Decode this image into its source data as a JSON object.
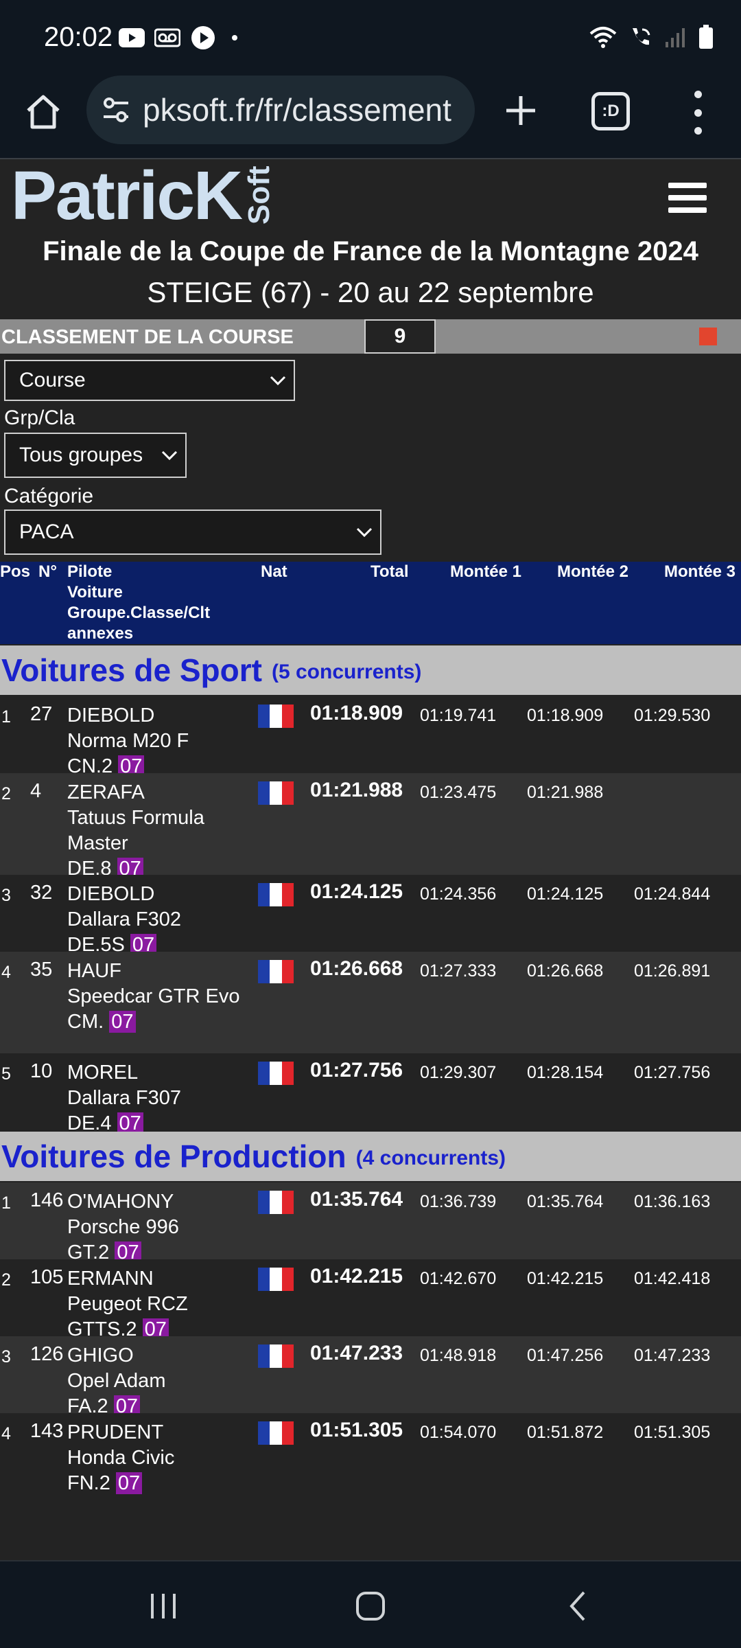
{
  "status_bar": {
    "time": "20:02",
    "left_icons": [
      "youtube-icon",
      "voicemail-icon",
      "play-icon"
    ],
    "right_icons": [
      "wifi-icon",
      "call-icon",
      "signal-icon",
      "battery-icon"
    ]
  },
  "browser": {
    "url": "pksoft.fr/fr/classement",
    "tabs_label": ":D"
  },
  "header": {
    "logo_main": "PatricK",
    "logo_suffix": "Soft",
    "title": "Finale de la Coupe de France de la Montagne 2024",
    "subtitle": "STEIGE (67) - 20 au 22 septembre"
  },
  "classement": {
    "label": "CLASSEMENT DE LA COURSE",
    "number": "9"
  },
  "filters": {
    "course_value": "Course",
    "grp_label": "Grp/Cla",
    "grp_value": "Tous groupes",
    "categorie_label": "Catégorie",
    "categorie_value": "PACA"
  },
  "table_header": {
    "pos": "Pos",
    "num": "N°",
    "pilote": "Pilote",
    "voiture": "Voiture",
    "groupe": "Groupe.Classe/Clt",
    "annexes": "annexes",
    "nat": "Nat",
    "total": "Total",
    "m1": "Montée 1",
    "m2": "Montée 2",
    "m3": "Montée 3"
  },
  "sections": [
    {
      "title": "Voitures de Sport",
      "count": "(5 concurrents)",
      "rows": [
        {
          "pos": "1",
          "num": "27",
          "pilote": "DIEBOLD",
          "voiture": "Norma M20 F",
          "groupe": "CN.2",
          "annexe": "07",
          "total": "01:18.909",
          "m1": "01:19.741",
          "m2": "01:18.909",
          "m3": "01:29.530"
        },
        {
          "pos": "2",
          "num": "4",
          "pilote": "ZERAFA",
          "voiture": "Tatuus Formula Master",
          "groupe": "DE.8",
          "annexe": "07",
          "total": "01:21.988",
          "m1": "01:23.475",
          "m2": "01:21.988",
          "m3": ""
        },
        {
          "pos": "3",
          "num": "32",
          "pilote": "DIEBOLD",
          "voiture": "Dallara F302",
          "groupe": "DE.5S",
          "annexe": "07",
          "total": "01:24.125",
          "m1": "01:24.356",
          "m2": "01:24.125",
          "m3": "01:24.844"
        },
        {
          "pos": "4",
          "num": "35",
          "pilote": "HAUF",
          "voiture": "Speedcar GTR Evo",
          "groupe": "CM.",
          "annexe": "07",
          "total": "01:26.668",
          "m1": "01:27.333",
          "m2": "01:26.668",
          "m3": "01:26.891"
        },
        {
          "pos": "5",
          "num": "10",
          "pilote": "MOREL",
          "voiture": "Dallara F307",
          "groupe": "DE.4",
          "annexe": "07",
          "total": "01:27.756",
          "m1": "01:29.307",
          "m2": "01:28.154",
          "m3": "01:27.756"
        }
      ]
    },
    {
      "title": "Voitures de Production",
      "count": "(4 concurrents)",
      "rows": [
        {
          "pos": "1",
          "num": "146",
          "pilote": "O'MAHONY",
          "voiture": "Porsche 996",
          "groupe": "GT.2",
          "annexe": "07",
          "total": "01:35.764",
          "m1": "01:36.739",
          "m2": "01:35.764",
          "m3": "01:36.163"
        },
        {
          "pos": "2",
          "num": "105",
          "pilote": "ERMANN",
          "voiture": "Peugeot RCZ",
          "groupe": "GTTS.2",
          "annexe": "07",
          "total": "01:42.215",
          "m1": "01:42.670",
          "m2": "01:42.215",
          "m3": "01:42.418"
        },
        {
          "pos": "3",
          "num": "126",
          "pilote": "GHIGO",
          "voiture": "Opel Adam",
          "groupe": "FA.2",
          "annexe": "07",
          "total": "01:47.233",
          "m1": "01:48.918",
          "m2": "01:47.256",
          "m3": "01:47.233"
        },
        {
          "pos": "4",
          "num": "143",
          "pilote": "PRUDENT",
          "voiture": "Honda Civic",
          "groupe": "FN.2",
          "annexe": "07",
          "total": "01:51.305",
          "m1": "01:54.070",
          "m2": "01:51.872",
          "m3": "01:51.305"
        }
      ]
    }
  ],
  "colors": {
    "flag_blue": "#1e3ea8",
    "flag_white": "#ffffff",
    "flag_red": "#e2252b",
    "annex_badge": "#8a1aa0",
    "section_title": "#1a22cc",
    "table_header_bg": "#0b1f66"
  },
  "nav_bar": {
    "icons": [
      "recents-icon",
      "home-icon",
      "back-icon"
    ]
  }
}
